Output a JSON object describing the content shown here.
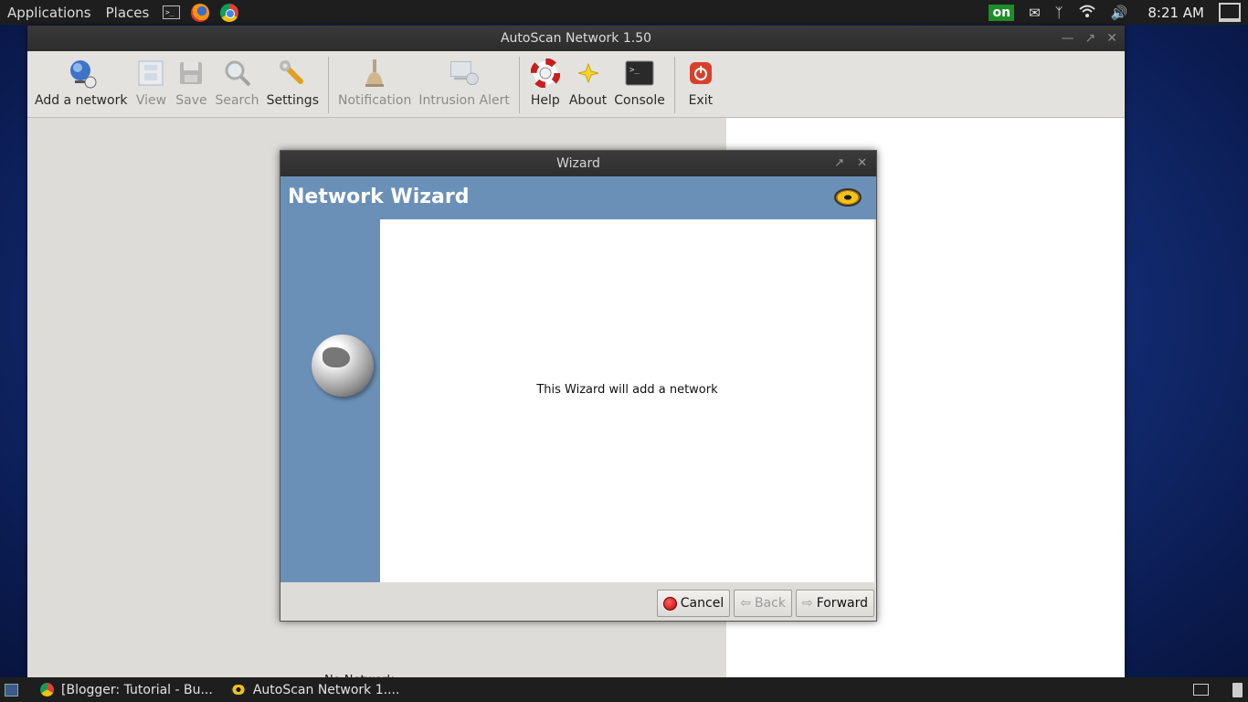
{
  "top_panel": {
    "applications_label": "Applications",
    "places_label": "Places",
    "terminal_glyph": ">_",
    "on_badge": "on",
    "clock": "8:21 AM"
  },
  "main_window": {
    "title": "AutoScan Network 1.50",
    "toolbar": {
      "add_network": "Add a network",
      "view": "View",
      "save": "Save",
      "search": "Search",
      "settings": "Settings",
      "notification": "Notification",
      "intrusion_alert": "Intrusion Alert",
      "help": "Help",
      "about": "About",
      "console": "Console",
      "exit": "Exit"
    },
    "partial_text": "No Network ..."
  },
  "wizard": {
    "title": "Wizard",
    "heading": "Network Wizard",
    "message": "This Wizard will add a network",
    "buttons": {
      "cancel": "Cancel",
      "back": "Back",
      "forward": "Forward"
    }
  },
  "taskbar": {
    "tasks": [
      {
        "label": "[Blogger: Tutorial - Bu..."
      },
      {
        "label": "AutoScan Network 1...."
      }
    ]
  },
  "colors": {
    "wizard_blue": "#6b90b7",
    "panel_dark": "#1e1e1e",
    "desktop_blue": "#163583"
  }
}
